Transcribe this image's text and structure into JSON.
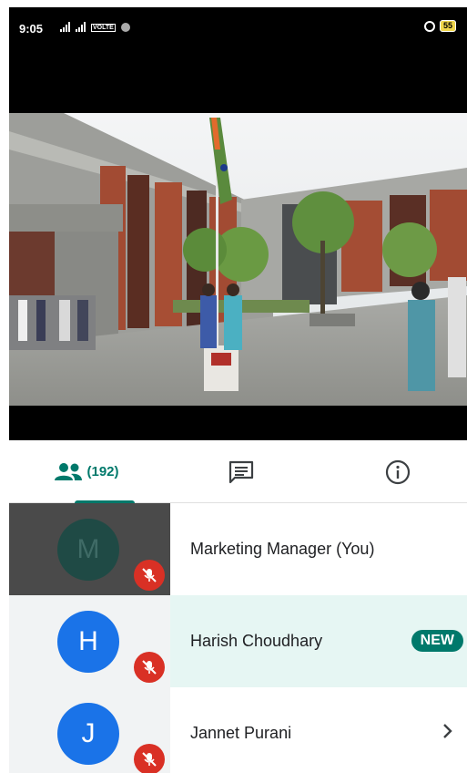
{
  "status_bar": {
    "time": "9:05",
    "battery": "55",
    "network_label": "VOLTE"
  },
  "video": {
    "description_icon": "flag-hoisting-photo"
  },
  "tabs": {
    "people_count": "(192)",
    "people_icon": "people-icon",
    "chat_icon": "chat-icon",
    "info_icon": "info-icon",
    "active": "people"
  },
  "participants": [
    {
      "initial": "M",
      "name": "Marketing Manager (You)",
      "avatar_color": "#1f4a45",
      "tile_bg": "#4a4a4a",
      "row_bg": "#ffffff",
      "muted": true
    },
    {
      "initial": "H",
      "name": "Harish Choudhary",
      "avatar_color": "#1a73e8",
      "tile_bg": "#f1f3f4",
      "row_bg": "#e6f6f3",
      "muted": true,
      "badge": "NEW"
    },
    {
      "initial": "J",
      "name": "Jannet Purani",
      "avatar_color": "#1a73e8",
      "tile_bg": "#f1f3f4",
      "row_bg": "#ffffff",
      "muted": true
    }
  ],
  "colors": {
    "accent": "#00796b",
    "mute_red": "#d93025"
  }
}
